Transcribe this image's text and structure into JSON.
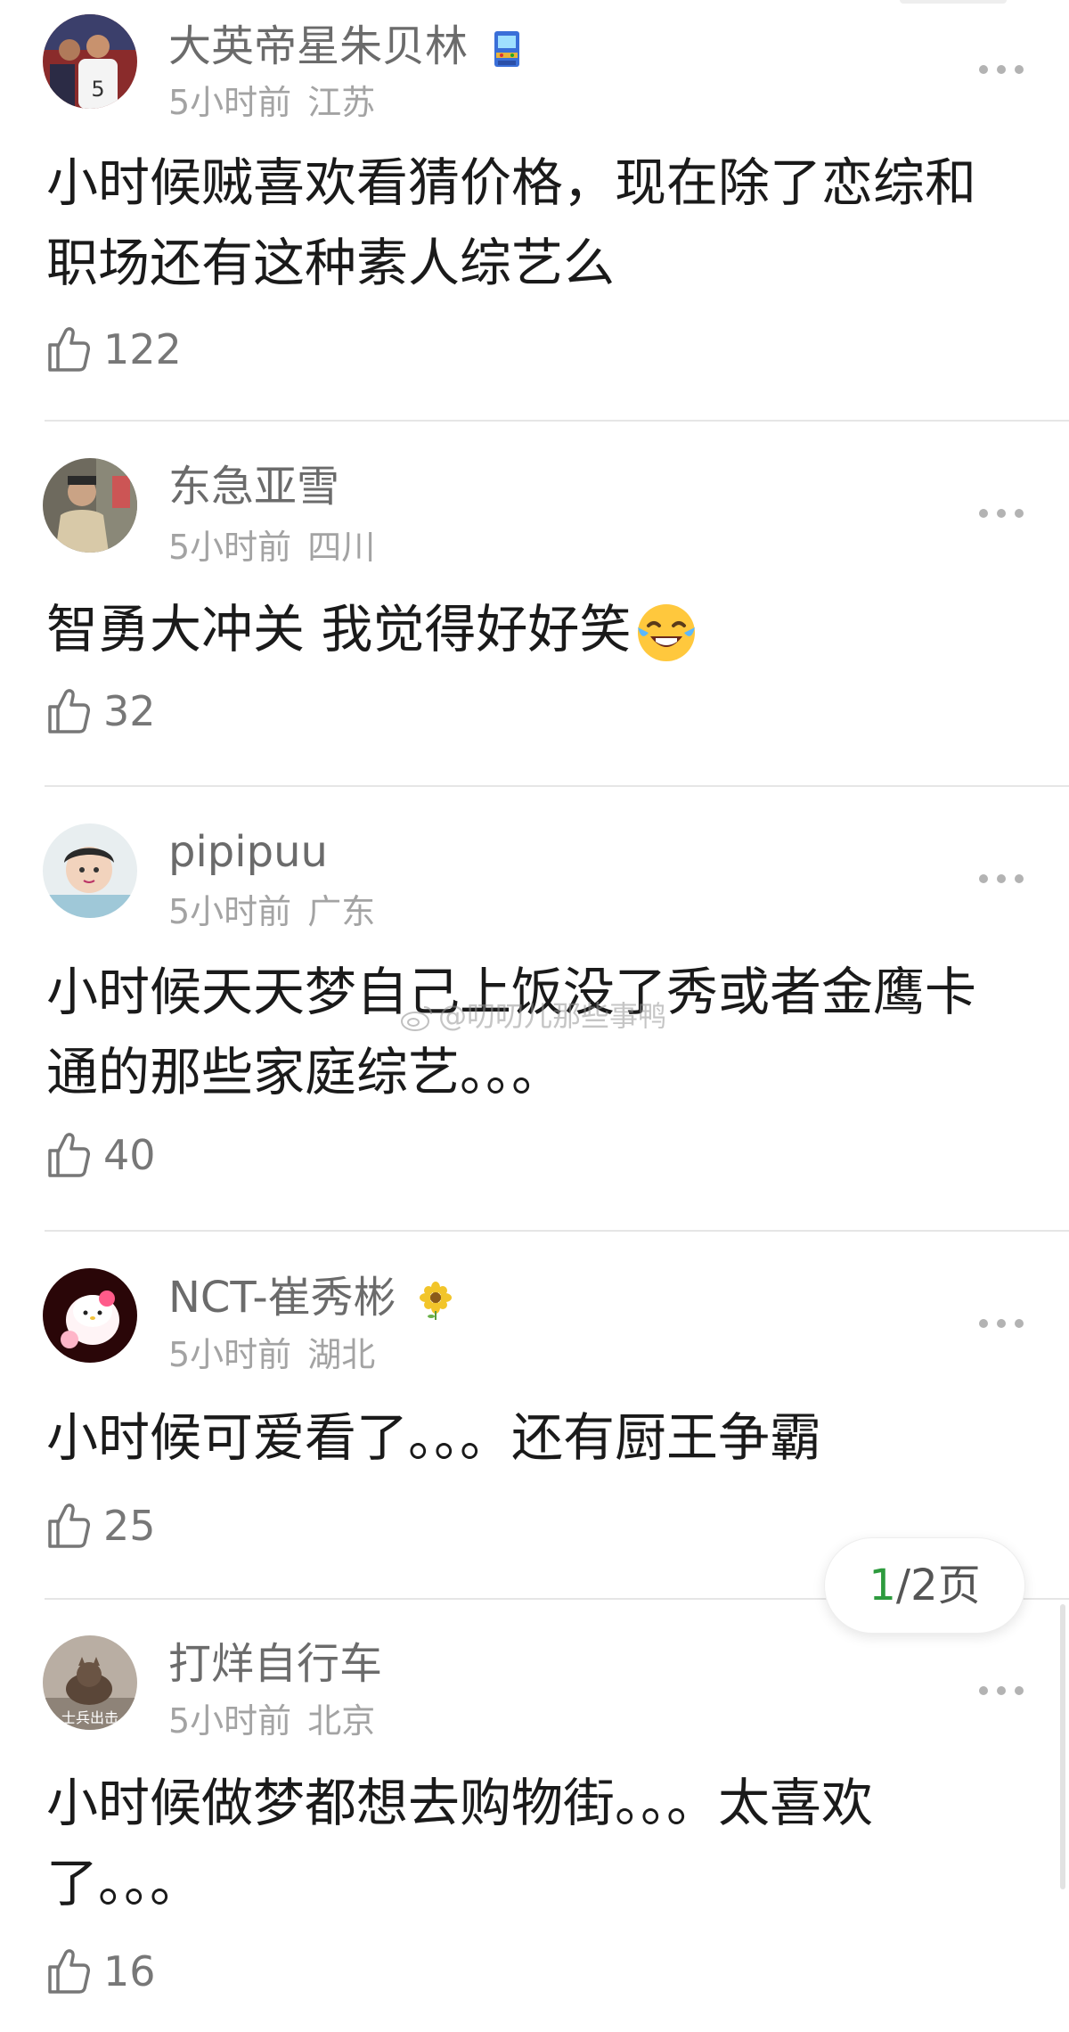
{
  "comments": [
    {
      "username": "大英帝星朱贝林",
      "time": "5小时前",
      "location": "江苏",
      "badge_icon": "arcade-machine-icon",
      "text_lines": [
        "小时候贼喜欢看猜价格，现在除了恋综和",
        "职场还有这种素人综艺么"
      ],
      "likes": "122"
    },
    {
      "username": "东急亚雪",
      "time": "5小时前",
      "location": "四川",
      "text_lines": [
        "智勇大冲关 我觉得好好笑"
      ],
      "emoji": "tears-of-joy-emoji",
      "likes": "32"
    },
    {
      "username": "pipipuu",
      "time": "5小时前",
      "location": "广东",
      "text_lines": [
        "小时候天天梦自己上饭没了秀或者金鹰卡",
        "通的那些家庭综艺。。。"
      ],
      "likes": "40"
    },
    {
      "username": "NCT-崔秀彬",
      "time": "5小时前",
      "location": "湖北",
      "badge_icon": "sunflower-icon",
      "text_lines": [
        "小时候可爱看了。。。还有厨王争霸"
      ],
      "likes": "25"
    },
    {
      "username": "打烊自行车",
      "time": "5小时前",
      "location": "北京",
      "avatar_caption": "士兵出击",
      "text_lines": [
        "小时候做梦都想去购物街。。。太喜欢",
        "了。。。"
      ],
      "likes": "16"
    }
  ],
  "pagination": {
    "current": "1",
    "total_text": "/2页"
  },
  "watermark": "@叨叨儿那些事鸭",
  "colors": {
    "accent_green": "#2e9b3e",
    "username_gray": "#6b6b6b",
    "meta_gray": "#a3a3a3",
    "divider": "#e6e6e6"
  }
}
